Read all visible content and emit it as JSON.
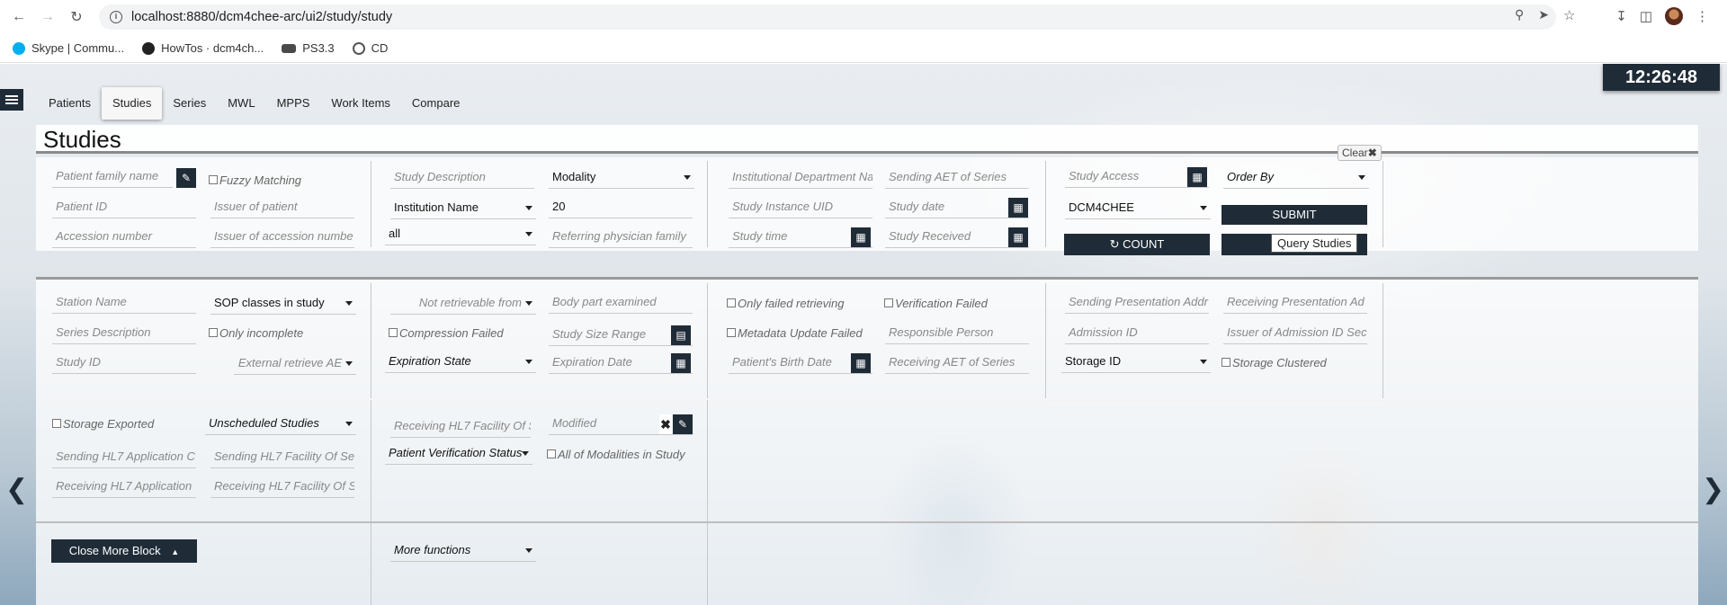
{
  "browser": {
    "url": "localhost:8880/dcm4chee-arc/ui2/study/study",
    "bookmarks": [
      "Skype | Commu...",
      "HowTos · dcm4ch...",
      "PS3.3",
      "CD"
    ]
  },
  "clock": "12:26:48",
  "tabs": [
    "Patients",
    "Studies",
    "Series",
    "MWL",
    "MPPS",
    "Work Items",
    "Compare"
  ],
  "page_title": "Studies",
  "clear_label": "Clear",
  "row1": {
    "patient_family_name": "Patient family name",
    "fuzzy_matching": "Fuzzy Matching",
    "patient_id": "Patient ID",
    "issuer_of_patient": "Issuer of patient",
    "accession_number": "Accession number",
    "issuer_of_accession": "Issuer of accession numbe",
    "study_description": "Study Description",
    "modality": "Modality",
    "institution_name": "Institution Name",
    "limit": "20",
    "all": "all",
    "referring_physician": "Referring physician family",
    "institutional_department": "Institutional Department Na",
    "sending_aet": "Sending AET of Series",
    "study_instance_uid": "Study Instance UID",
    "study_date": "Study date",
    "study_time": "Study time",
    "study_received": "Study Received",
    "study_access": "Study Access",
    "order_by": "Order By",
    "aet": "DCM4CHEE",
    "submit": "SUBMIT",
    "count": "COUNT",
    "tooltip": "Query Studies"
  },
  "row2": {
    "station_name": "Station Name",
    "sop_classes": "SOP classes in study",
    "series_description": "Series Description",
    "only_incomplete": "Only incomplete",
    "study_id": "Study ID",
    "external_retrieve": "External retrieve AE",
    "not_retrievable": "Not retrievable from",
    "body_part": "Body part examined",
    "compression_failed": "Compression Failed",
    "study_size_range": "Study Size Range",
    "expiration_state": "Expiration State",
    "expiration_date": "Expiration Date",
    "only_failed_retrieving": "Only failed retrieving",
    "verification_failed": "Verification Failed",
    "metadata_update_failed": "Metadata Update Failed",
    "responsible_person": "Responsible Person",
    "patient_birth_date": "Patient's Birth Date",
    "receiving_aet": "Receiving AET of Series",
    "sending_presentation": "Sending Presentation Addr",
    "receiving_presentation": "Receiving Presentation Ad",
    "admission_id": "Admission ID",
    "issuer_admission": "Issuer of Admission ID Sec",
    "storage_id": "Storage ID",
    "storage_clustered": "Storage Clustered"
  },
  "row3": {
    "storage_exported": "Storage Exported",
    "unscheduled_studies": "Unscheduled Studies",
    "receiving_hl7_facility_1": "Receiving HL7 Facility Of S",
    "modified": "Modified",
    "sending_hl7_app": "Sending HL7 Application C",
    "sending_hl7_facility": "Sending HL7 Facility Of Se",
    "patient_verification": "Patient Verification Status",
    "all_modalities": "All of Modalities in Study",
    "receiving_hl7_app": "Receiving HL7 Application",
    "receiving_hl7_facility_2": "Receiving HL7 Facility Of S",
    "close_more_block": "Close More Block",
    "more_functions": "More functions"
  }
}
